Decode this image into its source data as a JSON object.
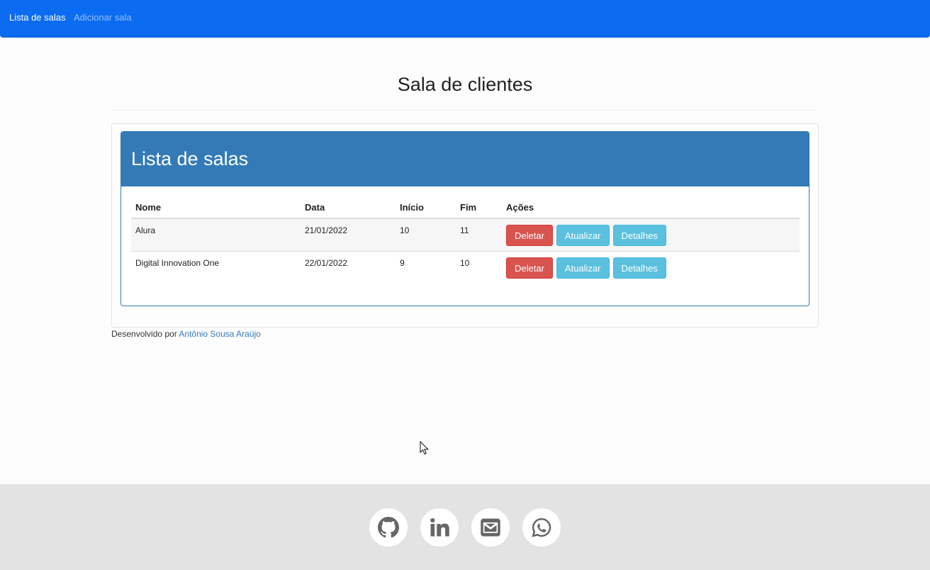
{
  "navbar": {
    "links": [
      {
        "label": "Lista de salas",
        "active": true
      },
      {
        "label": "Adicionar sala",
        "active": false
      }
    ]
  },
  "page": {
    "title": "Sala de clientes"
  },
  "panel": {
    "title": "Lista de salas",
    "columns": [
      "Nome",
      "Data",
      "Início",
      "Fim",
      "Ações"
    ],
    "rows": [
      {
        "nome": "Alura",
        "data": "21/01/2022",
        "inicio": "10",
        "fim": "11"
      },
      {
        "nome": "Digital Innovation One",
        "data": "22/01/2022",
        "inicio": "9",
        "fim": "10"
      }
    ],
    "actions": {
      "delete": "Deletar",
      "update": "Atualizar",
      "details": "Detalhes"
    }
  },
  "credit": {
    "prefix": "Desenvolvido por",
    "author": "Antônio Sousa Araújo"
  },
  "footer": {
    "icons": [
      "github-icon",
      "linkedin-icon",
      "email-icon",
      "whatsapp-icon"
    ]
  },
  "colors": {
    "navbar": "#0b6cf2",
    "panel_primary": "#337ab7",
    "danger": "#d9534f",
    "info": "#5bc0de",
    "footer_bg": "#e3e3e3",
    "footer_icon": "#666666"
  }
}
